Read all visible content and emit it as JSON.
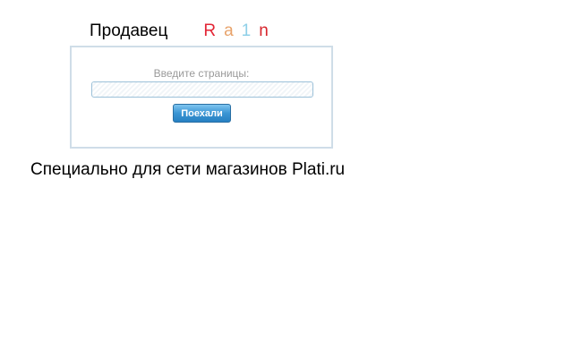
{
  "seller": {
    "label": "Продавец",
    "name_letters": [
      {
        "char": "R",
        "color": "#e32636"
      },
      {
        "char": "a",
        "color": "#e8a36b"
      },
      {
        "char": "1",
        "color": "#8fd0e8"
      },
      {
        "char": "n",
        "color": "#d7262d"
      }
    ]
  },
  "page_form": {
    "caption": "Введите страницы:",
    "input_value": "",
    "button_label": "Поехали"
  },
  "footer": {
    "text": "Специально для сети магазинов Plati.ru"
  }
}
